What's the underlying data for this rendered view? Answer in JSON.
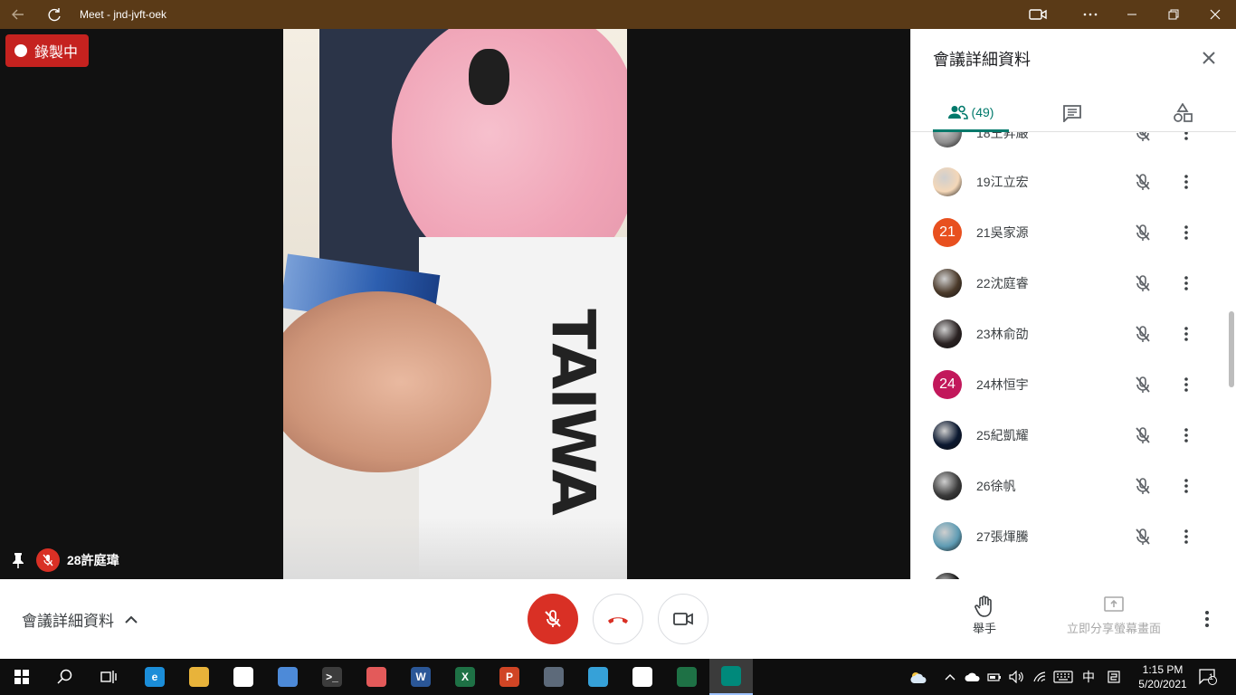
{
  "window": {
    "title": "Meet - jnd-jvft-oek"
  },
  "stage": {
    "recording_label": "錄製中",
    "video_text": "TAIWA",
    "self_name": "28許庭瑋"
  },
  "panel": {
    "title": "會議詳細資料",
    "people_count": "(49)",
    "participants": [
      {
        "name": "18王昇嚴",
        "avatar": "photo",
        "color": "#8d8d8d"
      },
      {
        "name": "19江立宏",
        "avatar": "photo",
        "color": "#f4d7b8"
      },
      {
        "name": "21吳家源",
        "avatar": "21",
        "color": "#e8501f"
      },
      {
        "name": "22沈庭睿",
        "avatar": "photo",
        "color": "#4b3a2a"
      },
      {
        "name": "23林俞劭",
        "avatar": "photo",
        "color": "#2a2222"
      },
      {
        "name": "24林恒宇",
        "avatar": "24",
        "color": "#c2185b"
      },
      {
        "name": "25紀凱耀",
        "avatar": "photo",
        "color": "#0b1830"
      },
      {
        "name": "26徐帆",
        "avatar": "photo",
        "color": "#3a3a3a"
      },
      {
        "name": "27張煇騰",
        "avatar": "photo",
        "color": "#5e9bb3"
      },
      {
        "name": "",
        "avatar": "photo",
        "color": "#111111"
      }
    ]
  },
  "bottom": {
    "meeting_details": "會議詳細資料",
    "raise_hand": "舉手",
    "present_now": "立即分享螢幕畫面"
  },
  "taskbar": {
    "time": "1:15 PM",
    "date": "5/20/2021",
    "ime": "中",
    "notifications": "1",
    "apps": [
      {
        "name": "edge",
        "color": "#1b8dd8",
        "label": "e"
      },
      {
        "name": "file-explorer",
        "color": "#e8b33a",
        "label": ""
      },
      {
        "name": "store",
        "color": "#ffffff",
        "label": ""
      },
      {
        "name": "control-panel",
        "color": "#4d8ad8",
        "label": ""
      },
      {
        "name": "terminal",
        "color": "#3c3c3c",
        "label": ">_"
      },
      {
        "name": "paint",
        "color": "#e35a5a",
        "label": ""
      },
      {
        "name": "word",
        "color": "#2b5797",
        "label": "W"
      },
      {
        "name": "excel",
        "color": "#1e7145",
        "label": "X"
      },
      {
        "name": "powerpoint",
        "color": "#d04525",
        "label": "P"
      },
      {
        "name": "settings",
        "color": "#5d6a7a",
        "label": ""
      },
      {
        "name": "paint3d",
        "color": "#36a1d8",
        "label": ""
      },
      {
        "name": "itunes",
        "color": "#ffffff",
        "label": ""
      },
      {
        "name": "sheets",
        "color": "#1e7145",
        "label": ""
      },
      {
        "name": "meet",
        "color": "#00897b",
        "label": ""
      }
    ]
  }
}
